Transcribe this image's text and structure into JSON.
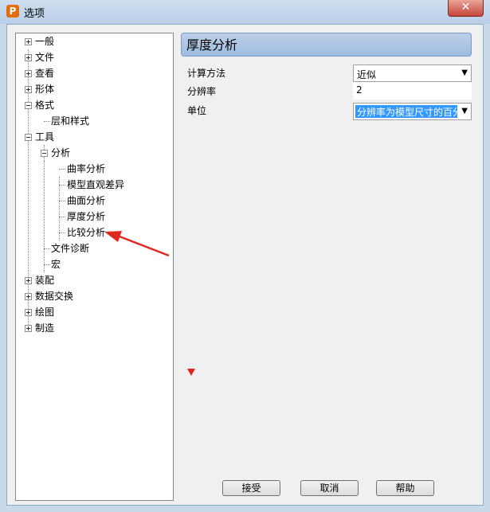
{
  "window": {
    "title": "选项",
    "app_icon": "P",
    "close_glyph": "✕"
  },
  "tree": {
    "items": [
      {
        "label": "一般",
        "expanded": false
      },
      {
        "label": "文件",
        "expanded": false
      },
      {
        "label": "查看",
        "expanded": false
      },
      {
        "label": "形体",
        "expanded": false
      },
      {
        "label": "格式",
        "expanded": true
      },
      {
        "label": "层和样式"
      },
      {
        "label": "工具",
        "expanded": true
      },
      {
        "label": "分析",
        "expanded": true
      },
      {
        "label": "曲率分析"
      },
      {
        "label": "模型直观差异"
      },
      {
        "label": "曲面分析"
      },
      {
        "label": "厚度分析"
      },
      {
        "label": "比较分析"
      },
      {
        "label": "文件诊断"
      },
      {
        "label": "宏"
      },
      {
        "label": "装配",
        "expanded": false
      },
      {
        "label": "数据交换",
        "expanded": false
      },
      {
        "label": "绘图",
        "expanded": false
      },
      {
        "label": "制造",
        "expanded": false
      }
    ]
  },
  "panel": {
    "title": "厚度分析",
    "properties": [
      {
        "label": "计算方法",
        "value": "近似",
        "kind": "dropdown"
      },
      {
        "label": "分辨率",
        "value": "2",
        "kind": "text"
      },
      {
        "label": "单位",
        "value": "分辨率为模型尺寸的百分比",
        "kind": "dropdown"
      }
    ]
  },
  "buttons": {
    "accept": "接受",
    "cancel": "取消",
    "help": "帮助"
  },
  "colors": {
    "annotation_arrow": "#e0281f",
    "selection": "#3399ff"
  }
}
